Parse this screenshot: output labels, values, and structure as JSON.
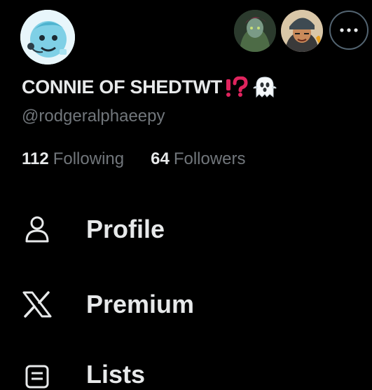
{
  "profile": {
    "display_name": "CONNIE OF SHEDTWT",
    "name_emoji_1": "⁉️",
    "name_emoji_2": "👻",
    "handle": "@rodgeralphaeepy",
    "following_count": "112",
    "following_label": "Following",
    "followers_count": "64",
    "followers_label": "Followers"
  },
  "accounts": [
    {
      "name": "account-avatar-1"
    },
    {
      "name": "account-avatar-2"
    }
  ],
  "menu": {
    "items": [
      {
        "label": "Profile",
        "icon": "person-icon"
      },
      {
        "label": "Premium",
        "icon": "x-logo-icon"
      },
      {
        "label": "Lists",
        "icon": "lists-icon"
      }
    ]
  },
  "colors": {
    "background": "#000000",
    "primary_text": "#e7e9ea",
    "secondary_text": "#71767b",
    "border": "#536471",
    "emoji_red": "#e0245e"
  }
}
